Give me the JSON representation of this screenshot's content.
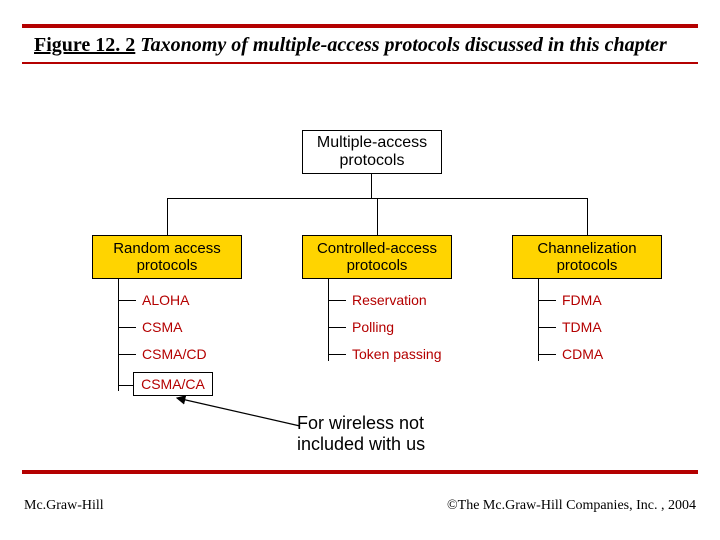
{
  "figure": {
    "number": "Figure 12. 2",
    "title": "Taxonomy of multiple-access protocols discussed in this chapter"
  },
  "root": {
    "line1": "Multiple-access",
    "line2": "protocols"
  },
  "categories": {
    "random": {
      "line1": "Random access",
      "line2": "protocols"
    },
    "controlled": {
      "line1": "Controlled-access",
      "line2": "protocols"
    },
    "channel": {
      "line1": "Channelization",
      "line2": "protocols"
    }
  },
  "leaves": {
    "random": [
      "ALOHA",
      "CSMA",
      "CSMA/CD",
      "CSMA/CA"
    ],
    "controlled": [
      "Reservation",
      "Polling",
      "Token passing"
    ],
    "channel": [
      "FDMA",
      "TDMA",
      "CDMA"
    ]
  },
  "note": {
    "line1": "For wireless not",
    "line2": "included with us"
  },
  "footer": {
    "left": "Mc.Graw-Hill",
    "right": "©The Mc.Graw-Hill Companies, Inc. , 2004"
  },
  "chart_data": {
    "type": "tree",
    "title": "Taxonomy of multiple-access protocols discussed in this chapter",
    "root": "Multiple-access protocols",
    "children": [
      {
        "name": "Random access protocols",
        "children": [
          "ALOHA",
          "CSMA",
          "CSMA/CD",
          "CSMA/CA"
        ]
      },
      {
        "name": "Controlled-access protocols",
        "children": [
          "Reservation",
          "Polling",
          "Token passing"
        ]
      },
      {
        "name": "Channelization protocols",
        "children": [
          "FDMA",
          "TDMA",
          "CDMA"
        ]
      }
    ],
    "annotation": {
      "target": "CSMA/CA",
      "text": "For wireless not included with us"
    }
  }
}
